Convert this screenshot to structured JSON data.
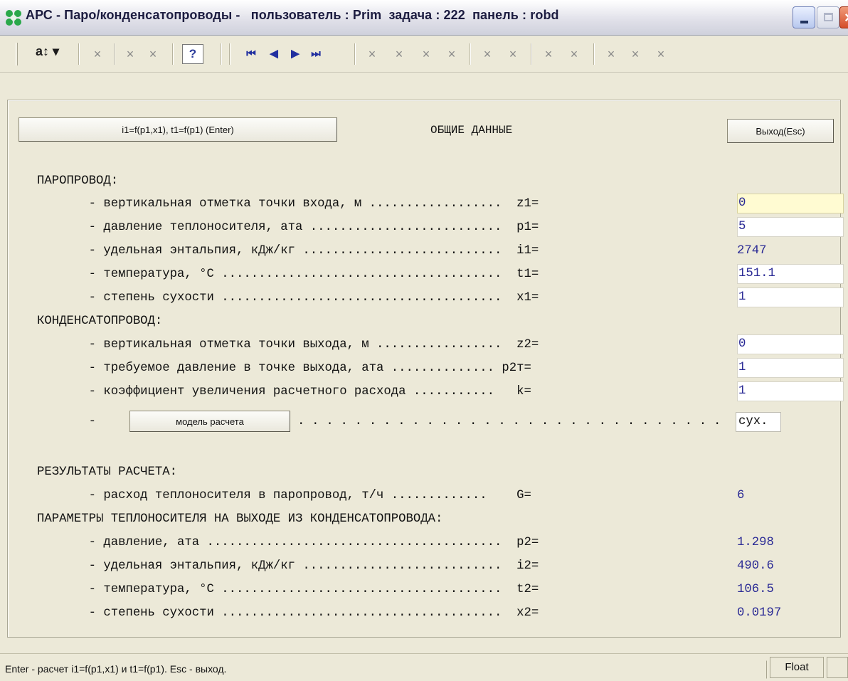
{
  "window": {
    "title": "АРС - Паро/конденсатопроводы -   пользователь : Prim  задача : 222  панель : robd"
  },
  "toolbar": {
    "sort_label": "a↕ ▾",
    "help_label": "?",
    "disabled_glyph": "×",
    "nav_first": "⏮",
    "nav_prev": "◀",
    "nav_next": "▶",
    "nav_last": "⏭"
  },
  "buttons": {
    "calc": "i1=f(p1,x1), t1=f(p1) (Enter)",
    "exit": "Выход(Esc)",
    "model": "модель расчета"
  },
  "heading": "ОБЩИЕ ДАННЫЕ",
  "sections": {
    "steam": "ПАРОПРОВОД:",
    "condensate": "КОНДЕНСАТОПРОВОД:",
    "results": "РЕЗУЛЬТАТЫ РАСЧЕТА:",
    "outlet": "ПАРАМЕТРЫ ТЕПЛОНОСИТЕЛЯ НА ВЫХОДЕ ИЗ КОНДЕНСАТОПРОВОДА:"
  },
  "rows": {
    "z1": {
      "label": "       - вертикальная отметка точки входа, м ..................  z1=",
      "value": "0"
    },
    "p1": {
      "label": "       - давление теплоносителя, ата ..........................  p1=",
      "value": "5"
    },
    "i1": {
      "label": "       - удельная энтальпия, кДж/кг ...........................  i1=",
      "value": "2747"
    },
    "t1": {
      "label": "       - температура, °С ......................................  t1=",
      "value": "151.1"
    },
    "x1": {
      "label": "       - степень сухости ......................................  x1=",
      "value": "1"
    },
    "z2": {
      "label": "       - вертикальная отметка точки выхода, м .................  z2=",
      "value": "0"
    },
    "p2t": {
      "label": "       - требуемое давление в точке выхода, ата .............. p2т=",
      "value": "1"
    },
    "k": {
      "label": "       - коэффициент увеличения расчетного расхода ...........   k=",
      "value": "1"
    },
    "model_dash": "       -",
    "model_dots": "..............................",
    "model_value": "сух.",
    "G": {
      "label": "       - расход теплоносителя в паропровод, т/ч .............    G=",
      "value": "6"
    },
    "p2": {
      "label": "       - давление, ата ........................................  p2=",
      "value": "1.298"
    },
    "i2": {
      "label": "       - удельная энтальпия, кДж/кг ...........................  i2=",
      "value": "490.6"
    },
    "t2": {
      "label": "       - температура, °С ......................................  t2=",
      "value": "106.5"
    },
    "x2": {
      "label": "       - степень сухости ......................................  x2=",
      "value": "0.0197"
    }
  },
  "status": {
    "message": "Enter - расчет i1=f(p1,x1) и t1=f(p1). Esc - выход.",
    "mode": "Float"
  },
  "colors": {
    "background": "#ece9d8",
    "value_text": "#2a2a95",
    "focused_field": "#fffbd2"
  }
}
